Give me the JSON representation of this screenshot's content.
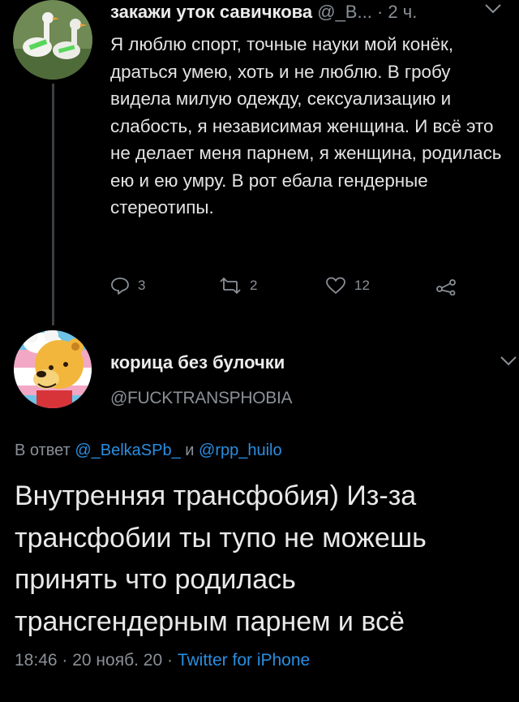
{
  "tweet1": {
    "author_name": "закажи уток савичкова",
    "handle": "@_B...",
    "time": "2 ч.",
    "text": "Я люблю спорт, точные науки мой конёк, драться умею, хоть и не люблю. В гробу видела милую одежду, сексуализацию и слабость, я независимая женщина. И всё это не делает меня парнем, я женщина, родилась ею и ею умру. В рот ебала гендерные стереотипы.",
    "replies": "3",
    "retweets": "2",
    "likes": "12"
  },
  "tweet2": {
    "author_name": "корица без булочки",
    "handle": "@FUCKTRANSPHOBIA",
    "reply_prefix": "В ответ",
    "reply_user1": "@_BelkaSPb_",
    "reply_and": "и",
    "reply_user2": "@rpp_huilo",
    "text": "Внутренняя трансфобия) Из-за трансфобии ты тупо не можешь принять что родилась трансгендерным парнем и всё",
    "time": "18:46",
    "date": "20 нояб. 20",
    "source": "Twitter for iPhone"
  },
  "colors": {
    "background": "#000000",
    "text": "#e6e6e6",
    "secondary": "#8a9096",
    "link": "#2a8ee0"
  }
}
